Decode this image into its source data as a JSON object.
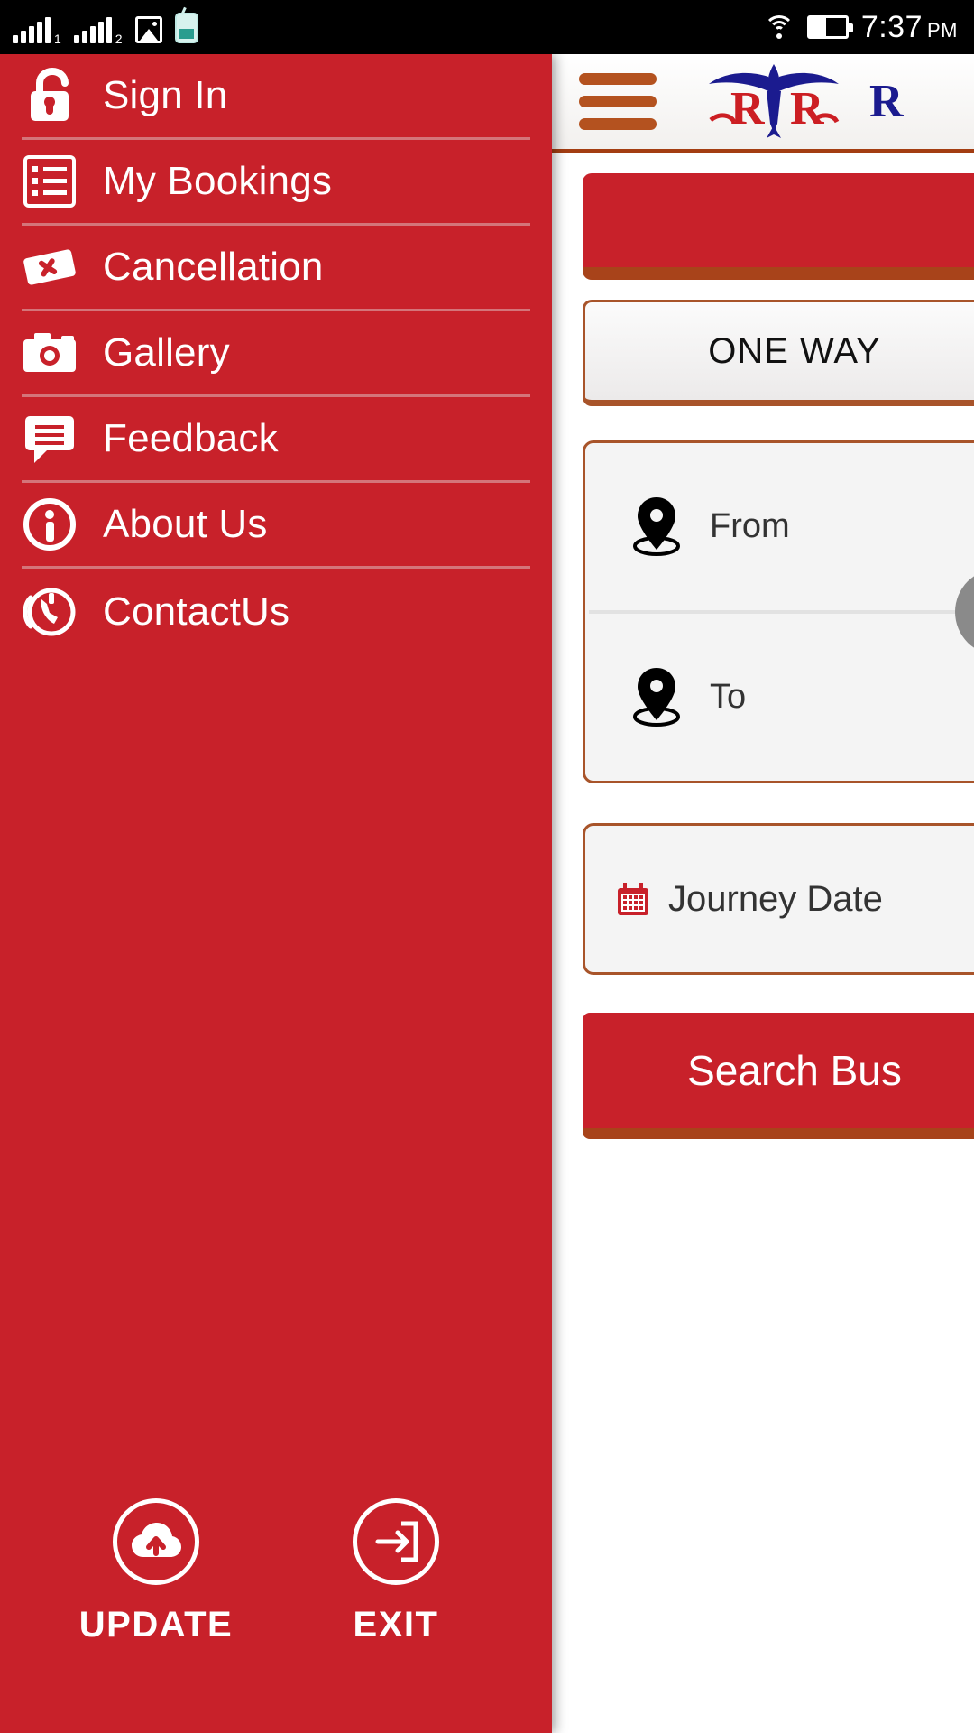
{
  "status_bar": {
    "sim1_label": "1",
    "sim2_label": "2",
    "icons": [
      "signal-sim1-icon",
      "signal-sim2-icon",
      "gallery-icon",
      "phone-app-icon",
      "wifi-icon",
      "battery-icon"
    ],
    "time": "7:37",
    "am_pm": "PM"
  },
  "app": {
    "header": {
      "menu_icon": "hamburger-menu-icon",
      "logo_text": "RVR",
      "logo_suffix": "R"
    },
    "trip_type_tab": "ONE WAY",
    "from_label": "From",
    "to_label": "To",
    "swap_icon": "swap-arrows-icon",
    "journey_date_label": "Journey Date",
    "search_button": "Search Bus"
  },
  "drawer": {
    "background_color": "#C8212A",
    "divider_color": "#D4757A",
    "text_color": "#FFFFFF",
    "items": [
      {
        "label": "Sign In",
        "icon": "unlocked-padlock-icon"
      },
      {
        "label": "My Bookings",
        "icon": "list-icon"
      },
      {
        "label": "Cancellation",
        "icon": "ticket-cancel-icon"
      },
      {
        "label": "Gallery",
        "icon": "camera-icon"
      },
      {
        "label": "Feedback",
        "icon": "chat-bubble-icon"
      },
      {
        "label": "About Us",
        "icon": "info-circle-icon"
      },
      {
        "label": "ContactUs",
        "icon": "phone-call-icon"
      }
    ],
    "footer": [
      {
        "label": "UPDATE",
        "icon": "cloud-upload-icon"
      },
      {
        "label": "EXIT",
        "icon": "exit-arrow-icon"
      }
    ]
  }
}
